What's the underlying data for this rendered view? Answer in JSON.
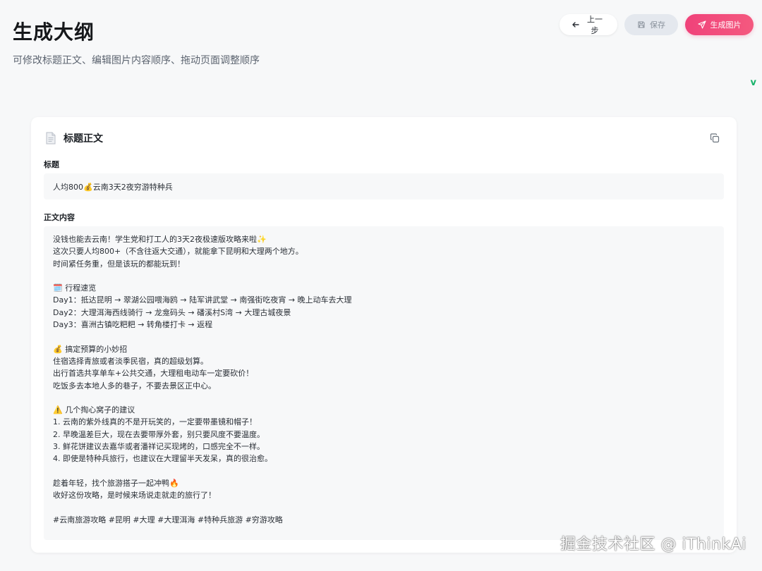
{
  "header": {
    "title": "生成大纲",
    "subtitle": "可修改标题正文、编辑图片内容顺序、拖动页面调整顺序"
  },
  "toolbar": {
    "back_label": "上一步",
    "save_label": "保存",
    "generate_label": "生成图片"
  },
  "brand_mark": "v",
  "card": {
    "title": "标题正文",
    "title_field_label": "标题",
    "title_value": "人均800💰云南3天2夜穷游特种兵",
    "body_field_label": "正文内容",
    "body_lines": [
      "没钱也能去云南！学生党和打工人的3天2夜极速版攻略来啦✨",
      "这次只要人均800+（不含往返大交通），就能拿下昆明和大理两个地方。",
      "时间紧任务重，但是该玩的都能玩到！",
      "",
      "🗓️ 行程速览",
      "Day1：抵达昆明 → 翠湖公园喂海鸥 → 陆军讲武堂 → 南强街吃夜宵 → 晚上动车去大理",
      "Day2：大理洱海西线骑行 → 龙龛码头 → 磻溪村S湾 → 大理古城夜景",
      "Day3：喜洲古镇吃粑粑 → 转角楼打卡 → 返程",
      "",
      "💰 搞定预算的小妙招",
      "住宿选择青旅或者淡季民宿，真的超级划算。",
      "出行首选共享单车+公共交通，大理租电动车一定要砍价！",
      "吃饭多去本地人多的巷子，不要去景区正中心。",
      "",
      "⚠️ 几个掏心窝子的建议",
      "1. 云南的紫外线真的不是开玩笑的，一定要带墨镜和帽子！",
      "2. 早晚温差巨大，现在去要带厚外套，别只要风度不要温度。",
      "3. 鲜花饼建议去嘉华或者潘祥记买现烤的，口感完全不一样。",
      "4. 即使是特种兵旅行，也建议在大理留半天发呆，真的很治愈。",
      "",
      "趁着年轻，找个旅游搭子一起冲鸭🔥",
      "收好这份攻略，是时候来场说走就走的旅行了！",
      "",
      "#云南旅游攻略 #昆明 #大理 #大理洱海 #特种兵旅游 #穷游攻略"
    ]
  },
  "watermark": "掘金技术社区 @ iThinkAi",
  "icons": {
    "back": "arrow-left-icon",
    "save": "save-icon",
    "generate": "send-icon",
    "card": "document-icon",
    "copy": "copy-icon"
  },
  "colors": {
    "accent": "#f0427a",
    "background": "#f7f8f9",
    "save_disabled_bg": "#e4e8ee",
    "brand_mark": "#17b26a"
  }
}
